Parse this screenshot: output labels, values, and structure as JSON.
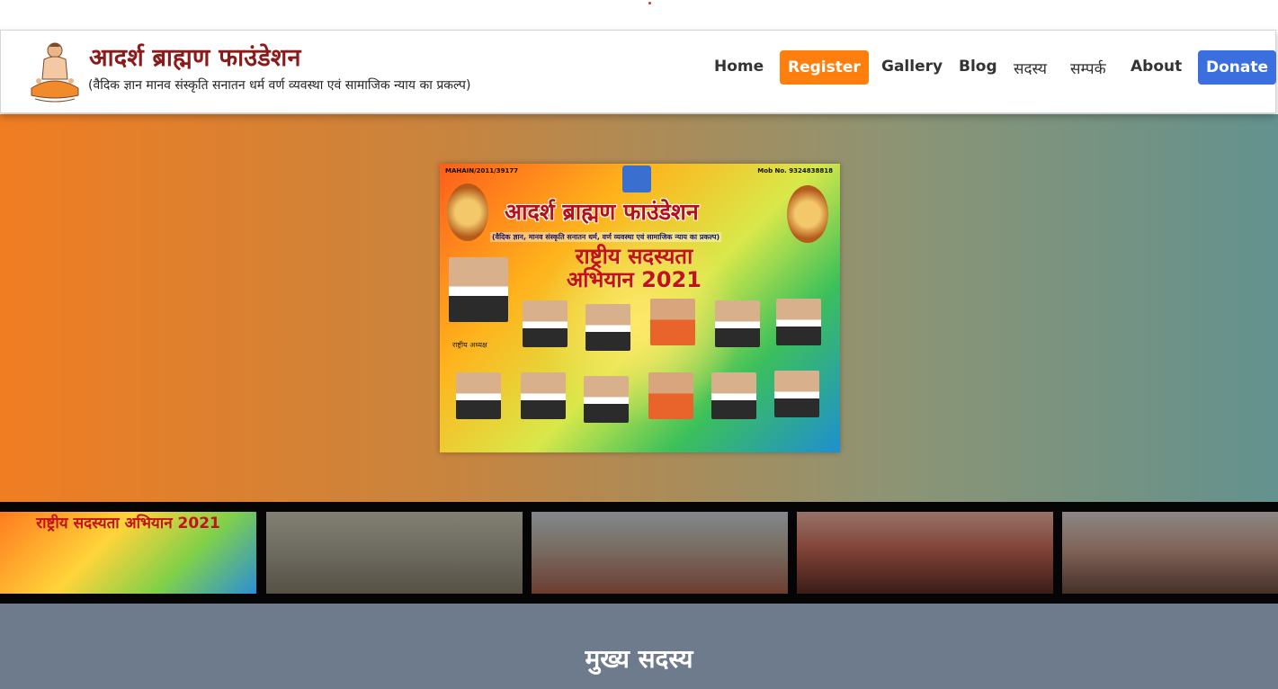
{
  "brand": {
    "title": "आदर्श ब्राह्मण फाउंडेशन",
    "tagline": "(वैदिक ज्ञान मानव संस्कृति सनातन धर्म वर्ण व्यवस्था एवं सामाजिक न्याय का प्रकल्प)",
    "logo_icon": "meditating-sage-icon"
  },
  "nav": {
    "home": "Home",
    "register": "Register",
    "gallery": "Gallery",
    "blog": "Blog",
    "members": "सदस्य",
    "contact": "सम्पर्क",
    "about": "About",
    "donate": "Donate"
  },
  "colors": {
    "register_bg": "#ff7f0e",
    "donate_bg": "#3b6fe0",
    "brand_title": "#8b1a1a",
    "section_bg": "#6e7b8d"
  },
  "hero": {
    "poster": {
      "reg_no": "MAHAIN/2011/39177",
      "mobile": "Mob No. 9324838818",
      "title": "आदर्श ब्राह्मण फाउंडेशन",
      "subtitle": "(वैदिक ज्ञान, मानव संस्कृति सनातन धर्म, वर्ण व्यवस्था एवं सामाजिक न्याय का प्रकल्प)",
      "campaign_line1": "राष्ट्रीय सदस्यता",
      "campaign_line2": "अभियान 2021",
      "lead_caption": "राष्ट्रीय अध्यक्ष"
    }
  },
  "thumbnails": [
    {
      "label": "राष्ट्रीय सदस्यता अभियान 2021"
    },
    {
      "label": ""
    },
    {
      "label": ""
    },
    {
      "label": ""
    },
    {
      "label": ""
    }
  ],
  "section": {
    "title": "मुख्य सदस्य"
  }
}
